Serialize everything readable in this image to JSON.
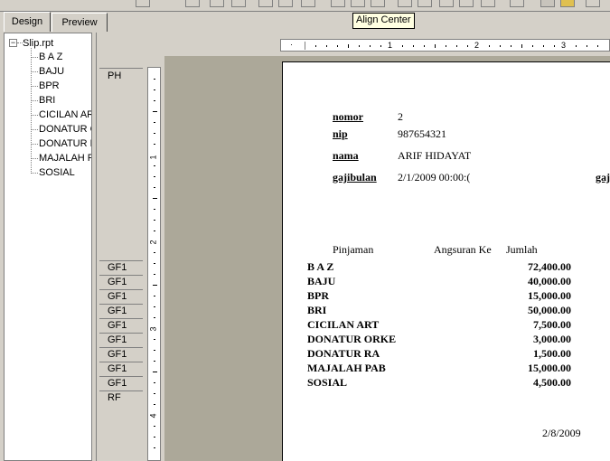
{
  "tabs": {
    "design": "Design",
    "preview": "Preview"
  },
  "tooltip": "Align Center",
  "tree": {
    "root": "Slip.rpt",
    "expander": "−",
    "items": [
      "B A Z",
      "BAJU",
      "BPR",
      "BRI",
      "CICILAN AR",
      "DONATUR C",
      "DONATUR R",
      "MAJALAH P.",
      "SOSIAL"
    ]
  },
  "sections": {
    "ph": "PH",
    "gf": [
      "GF1",
      "GF1",
      "GF1",
      "GF1",
      "GF1",
      "GF1",
      "GF1",
      "GF1",
      "GF1"
    ],
    "rf": "RF"
  },
  "ruler": {
    "h_numbers": [
      "1",
      "2",
      "3"
    ],
    "v_numbers": [
      "1",
      "2",
      "3",
      "4"
    ],
    "origin": "·"
  },
  "report": {
    "fields": [
      {
        "label": "nomor",
        "value": "2"
      },
      {
        "label": "nip",
        "value": "987654321"
      },
      {
        "label": "nama",
        "value": "ARIF HIDAYAT"
      },
      {
        "label": "gajibulan",
        "value": "2/1/2009  00:00:("
      }
    ],
    "cut_label": "gaj",
    "columns": {
      "pinjaman": "Pinjaman",
      "angsuran": "Angsuran Ke",
      "jumlah": "Jumlah"
    },
    "rows": [
      {
        "name": "B A Z",
        "amount": "72,400.00"
      },
      {
        "name": "BAJU",
        "amount": "40,000.00"
      },
      {
        "name": "BPR",
        "amount": "15,000.00"
      },
      {
        "name": "BRI",
        "amount": "50,000.00"
      },
      {
        "name": "CICILAN ART",
        "amount": "7,500.00"
      },
      {
        "name": "DONATUR ORKE",
        "amount": "3,000.00"
      },
      {
        "name": "DONATUR RA",
        "amount": "1,500.00"
      },
      {
        "name": "MAJALAH PAB",
        "amount": "15,000.00"
      },
      {
        "name": "SOSIAL",
        "amount": "4,500.00"
      }
    ],
    "footer_date": "2/8/2009"
  }
}
